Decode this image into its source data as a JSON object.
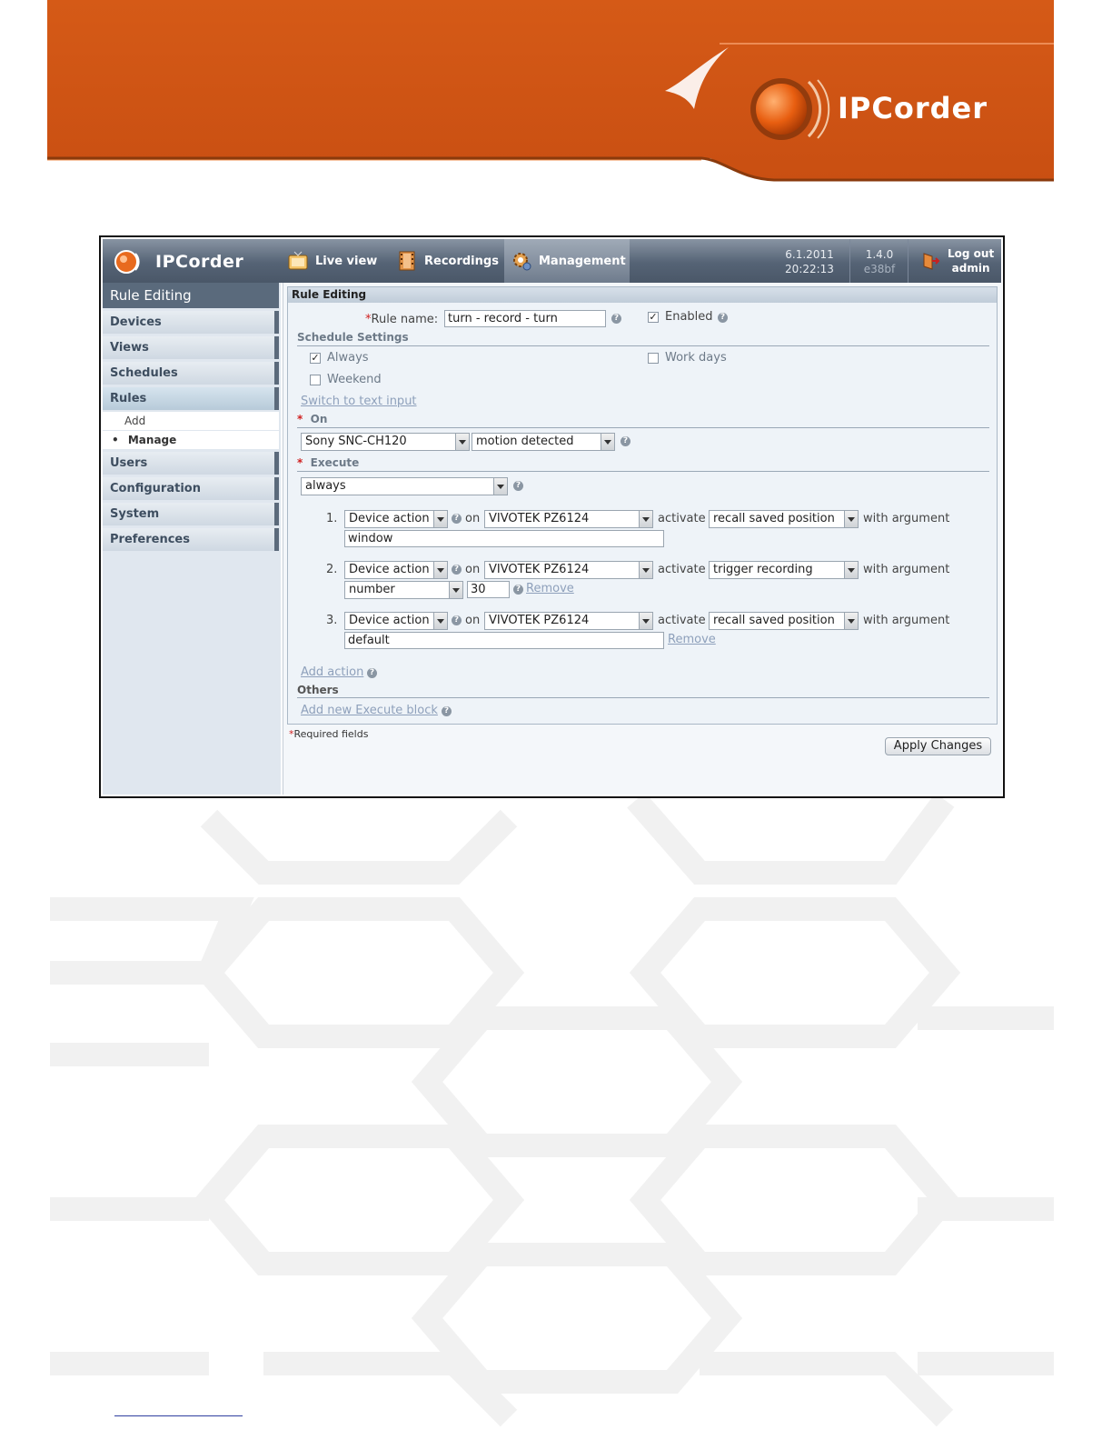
{
  "brand": {
    "name": "IPCorder"
  },
  "header": {
    "app_name": "IPCorder",
    "nav": [
      {
        "label": "Live view",
        "icon": "tv-icon"
      },
      {
        "label": "Recordings",
        "icon": "film-icon"
      },
      {
        "label": "Management",
        "icon": "gear-icon"
      }
    ],
    "date": "6.1.2011",
    "time": "20:22:13",
    "version": "1.4.0",
    "build": "e38bf",
    "logout": "Log out",
    "user": "admin"
  },
  "sidebar": {
    "title": "Rule Editing",
    "items": [
      "Devices",
      "Views",
      "Schedules",
      "Rules",
      "Users",
      "Configuration",
      "System",
      "Preferences"
    ],
    "rules_sub": [
      "Add",
      "Manage"
    ],
    "bullet": "•"
  },
  "form": {
    "panel_title": "Rule Editing",
    "required_mark": "*",
    "rule_name_label": "Rule name:",
    "rule_name_value": "turn - record - turn",
    "enabled_label": "Enabled",
    "schedule_heading": "Schedule Settings",
    "always_label": "Always",
    "work_days_label": "Work days",
    "weekend_label": "Weekend",
    "switch_link": "Switch to text input",
    "on_heading": "On",
    "on_device": "Sony SNC-CH120",
    "on_event": "motion detected",
    "execute_heading": "Execute",
    "execute_condition": "always",
    "word_on": "on",
    "word_activate": "activate",
    "word_with_argument": "with argument",
    "remove_link": "Remove",
    "actions": [
      {
        "num": "1.",
        "type": "Device action",
        "device": "VIVOTEK PZ6124",
        "function": "recall saved position",
        "argument": "window"
      },
      {
        "num": "2.",
        "type": "Device action",
        "device": "VIVOTEK PZ6124",
        "function": "trigger recording",
        "arg_type": "number",
        "argument": "30"
      },
      {
        "num": "3.",
        "type": "Device action",
        "device": "VIVOTEK PZ6124",
        "function": "recall saved position",
        "argument": "default"
      }
    ],
    "add_action": "Add action",
    "others_heading": "Others",
    "add_block": "Add new Execute block",
    "required_fields": "Required fields",
    "apply_button": "Apply Changes"
  },
  "help_glyph": "?",
  "check_glyph": "✓",
  "colors": {
    "brand_orange": "#d3591a",
    "header_slate": "#556375",
    "link": "#6f86a8"
  }
}
